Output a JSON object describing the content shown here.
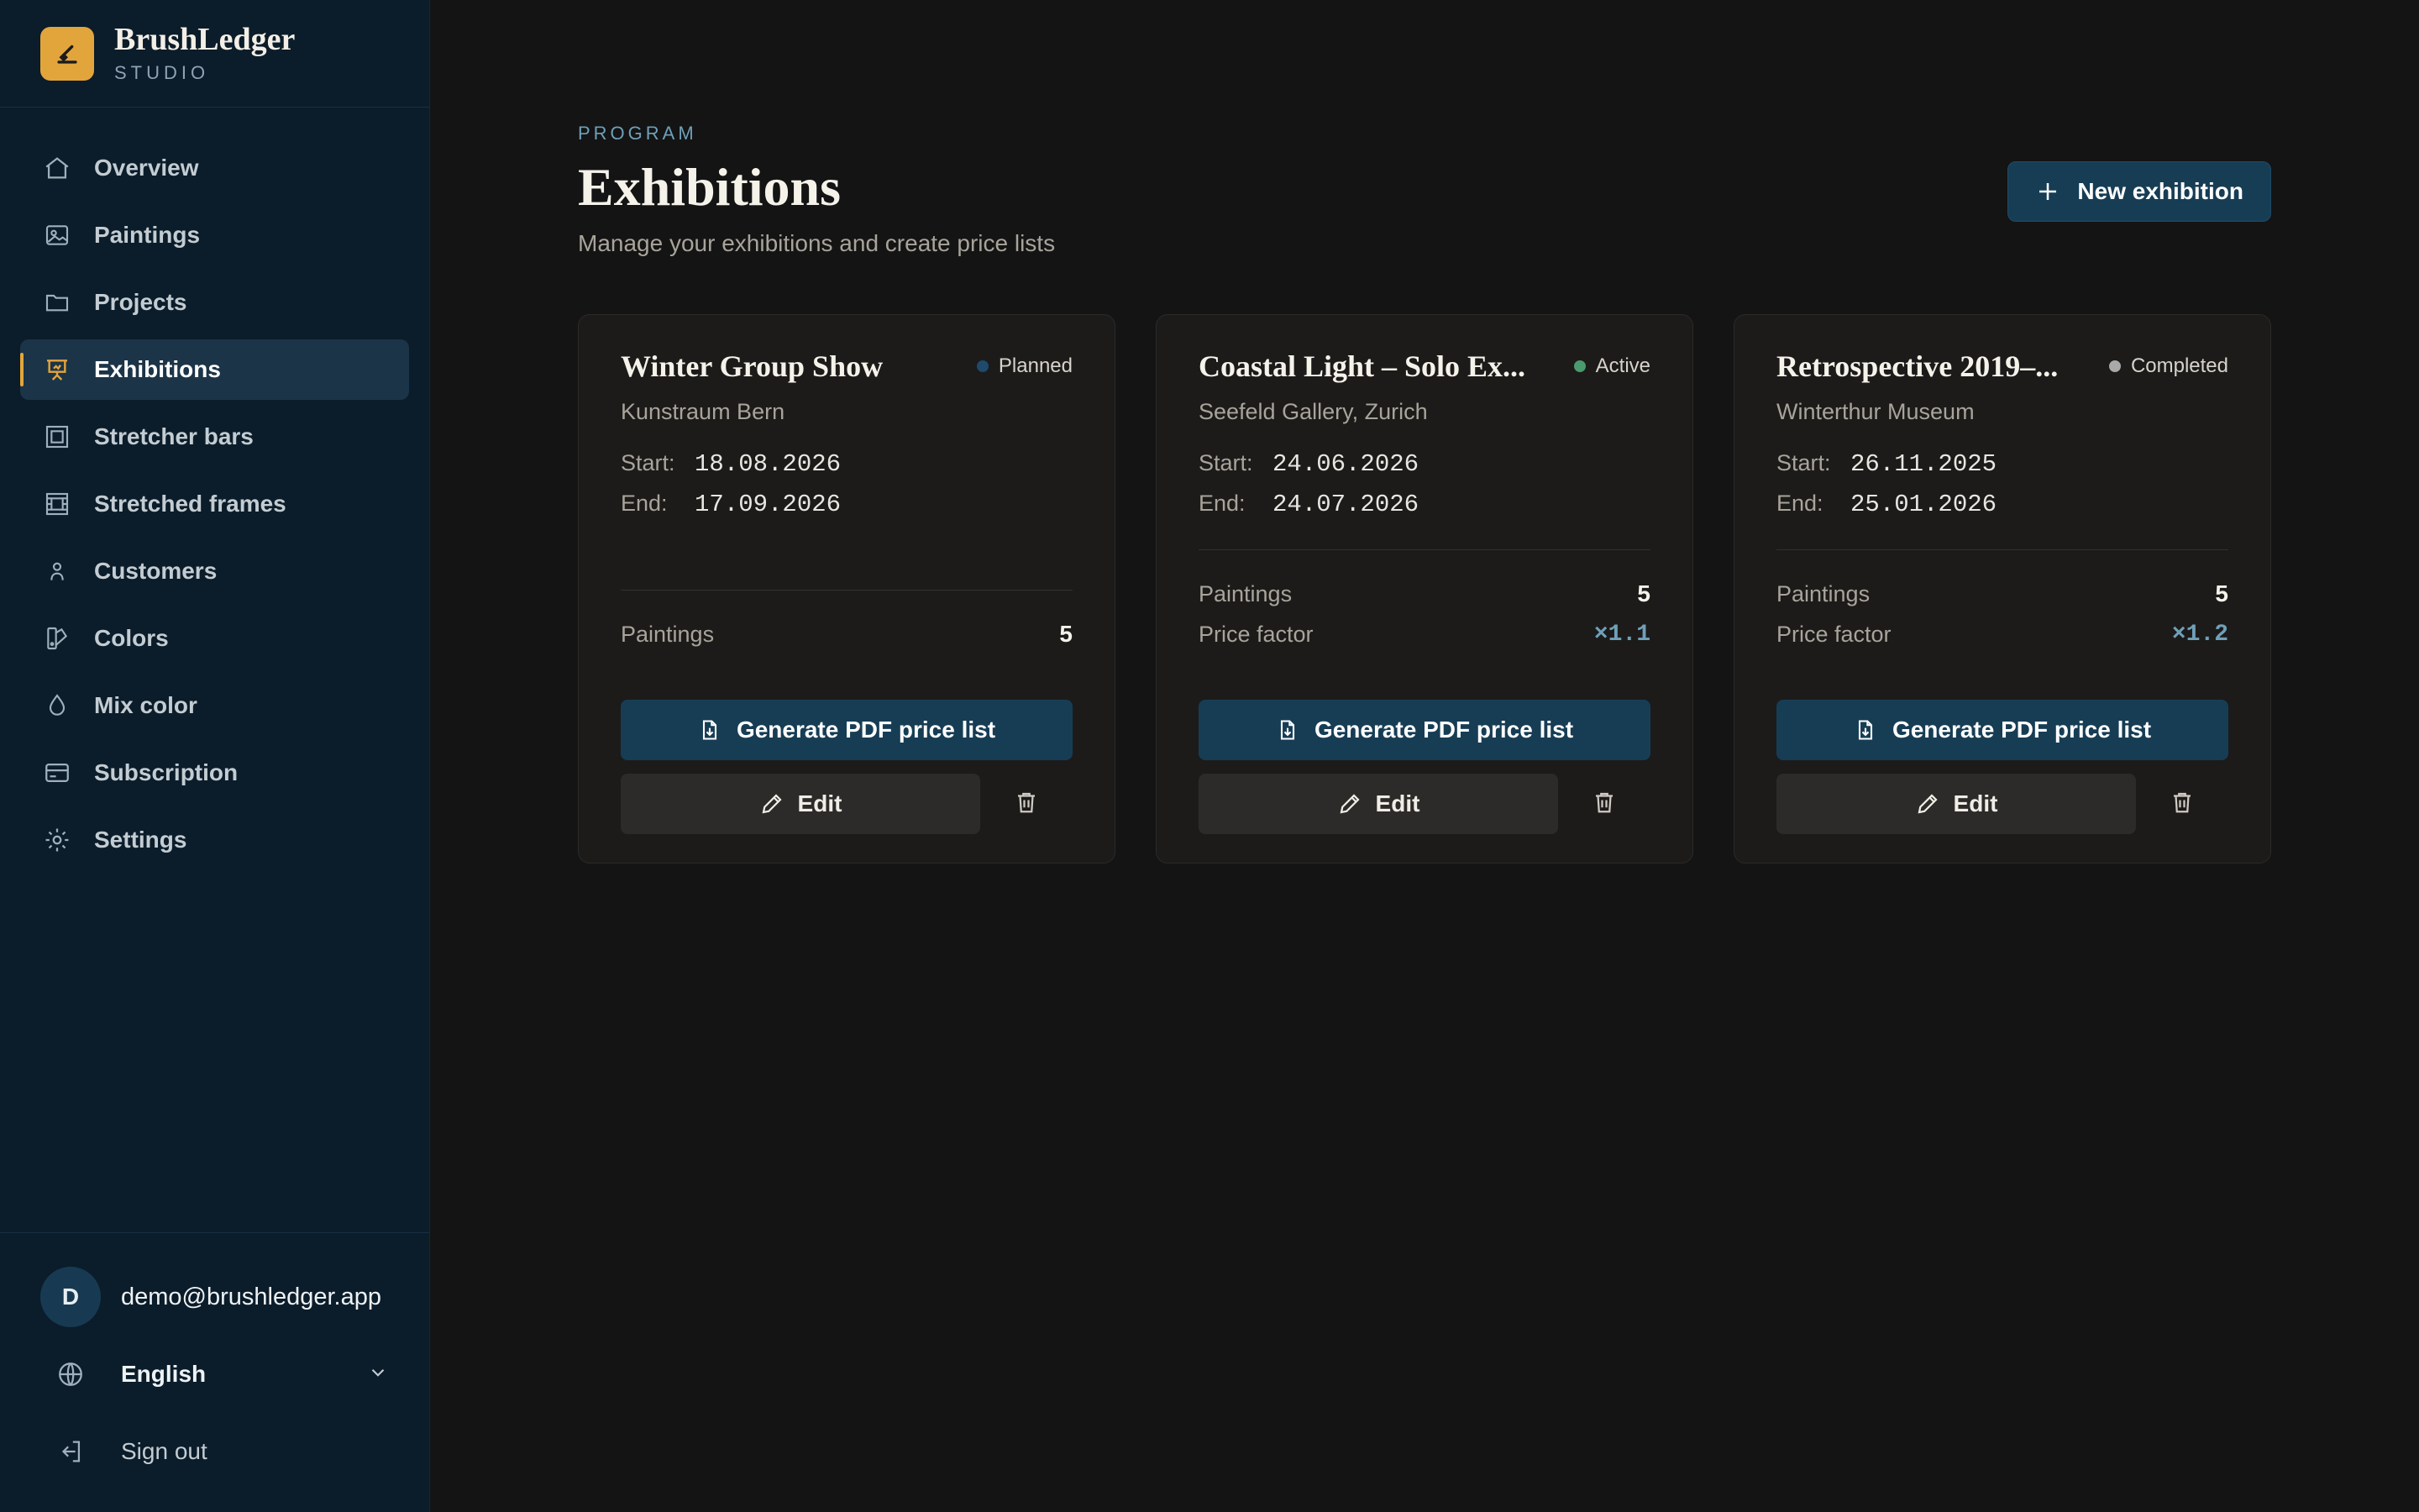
{
  "brand": {
    "name": "BrushLedger",
    "subtitle": "STUDIO",
    "logo_icon": "brush-icon",
    "accent": "#e2a53c"
  },
  "sidebar": {
    "items": [
      {
        "label": "Overview",
        "icon": "home-icon",
        "active": false
      },
      {
        "label": "Paintings",
        "icon": "image-icon",
        "active": false
      },
      {
        "label": "Projects",
        "icon": "folder-icon",
        "active": false
      },
      {
        "label": "Exhibitions",
        "icon": "presentation-icon",
        "active": true
      },
      {
        "label": "Stretcher bars",
        "icon": "square-frame-icon",
        "active": false
      },
      {
        "label": "Stretched frames",
        "icon": "film-frame-icon",
        "active": false
      },
      {
        "label": "Customers",
        "icon": "user-icon",
        "active": false
      },
      {
        "label": "Colors",
        "icon": "swatch-icon",
        "active": false
      },
      {
        "label": "Mix color",
        "icon": "droplet-icon",
        "active": false
      },
      {
        "label": "Subscription",
        "icon": "credit-card-icon",
        "active": false
      },
      {
        "label": "Settings",
        "icon": "gear-icon",
        "active": false
      }
    ],
    "user": {
      "initial": "D",
      "email": "demo@brushledger.app"
    },
    "language": {
      "selected": "English",
      "icon": "globe-icon"
    },
    "sign_out": "Sign out"
  },
  "header": {
    "eyebrow": "PROGRAM",
    "title": "Exhibitions",
    "subtitle": "Manage your exhibitions and create price lists",
    "new_button": "New exhibition"
  },
  "labels": {
    "start": "Start:",
    "end": "End:",
    "paintings": "Paintings",
    "price_factor": "Price factor",
    "pdf_button": "Generate PDF price list",
    "edit_button": "Edit"
  },
  "exhibitions": [
    {
      "title": "Winter Group Show",
      "status": "Planned",
      "status_color": "#1f4a6b",
      "venue": "Kunstraum Bern",
      "start": "18.08.2026",
      "end": "17.09.2026",
      "paintings": "5",
      "price_factor": ""
    },
    {
      "title": "Coastal Light – Solo Ex...",
      "status": "Active",
      "status_color": "#4a9a6e",
      "venue": "Seefeld Gallery, Zurich",
      "start": "24.06.2026",
      "end": "24.07.2026",
      "paintings": "5",
      "price_factor": "×1.1"
    },
    {
      "title": "Retrospective 2019–...",
      "status": "Completed",
      "status_color": "#a9a9a9",
      "venue": "Winterthur Museum",
      "start": "26.11.2025",
      "end": "25.01.2026",
      "paintings": "5",
      "price_factor": "×1.2"
    }
  ]
}
